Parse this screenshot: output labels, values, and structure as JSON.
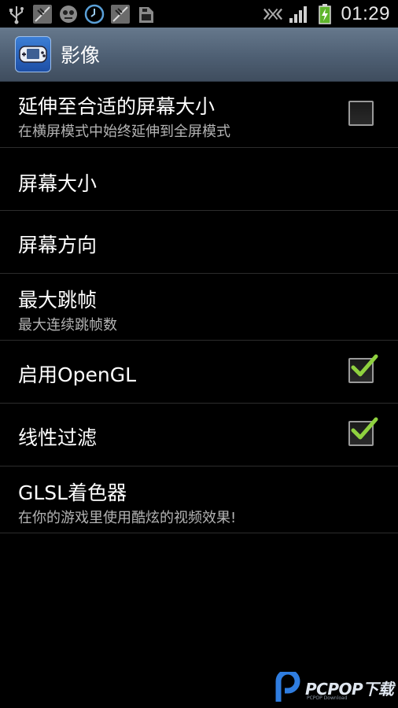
{
  "status_bar": {
    "left_icons": [
      "usb-icon",
      "no-sim-icon",
      "game-notification-icon",
      "clock-app-icon",
      "no-sim-icon",
      "storage-icon"
    ],
    "right_icons": [
      "wifi-disabled-icon",
      "signal-strength-icon",
      "battery-charging-icon"
    ],
    "time": "01:29"
  },
  "action_bar": {
    "app_icon": "gba-emulator-icon",
    "title": "影像"
  },
  "preferences": [
    {
      "title": "延伸至合适的屏幕大小",
      "summary": "在横屏模式中始终延伸到全屏模式",
      "checkbox": true,
      "checked": false
    },
    {
      "title": "屏幕大小",
      "summary": "",
      "checkbox": false,
      "checked": false
    },
    {
      "title": "屏幕方向",
      "summary": "",
      "checkbox": false,
      "checked": false
    },
    {
      "title": "最大跳帧",
      "summary": "最大连续跳帧数",
      "checkbox": false,
      "checked": false
    },
    {
      "title": "启用OpenGL",
      "summary": "",
      "checkbox": true,
      "checked": true
    },
    {
      "title": "线性过滤",
      "summary": "",
      "checkbox": true,
      "checked": true
    },
    {
      "title": "GLSL着色器",
      "summary": "在你的游戏里使用酷炫的视频效果!",
      "checkbox": false,
      "checked": false
    }
  ],
  "watermark": {
    "text": "PCPOP下载",
    "sub": "PCPOP Download"
  },
  "colors": {
    "action_bar": "#56677b",
    "check_mark": "#8fd13f",
    "divider": "#2c2c2c"
  }
}
